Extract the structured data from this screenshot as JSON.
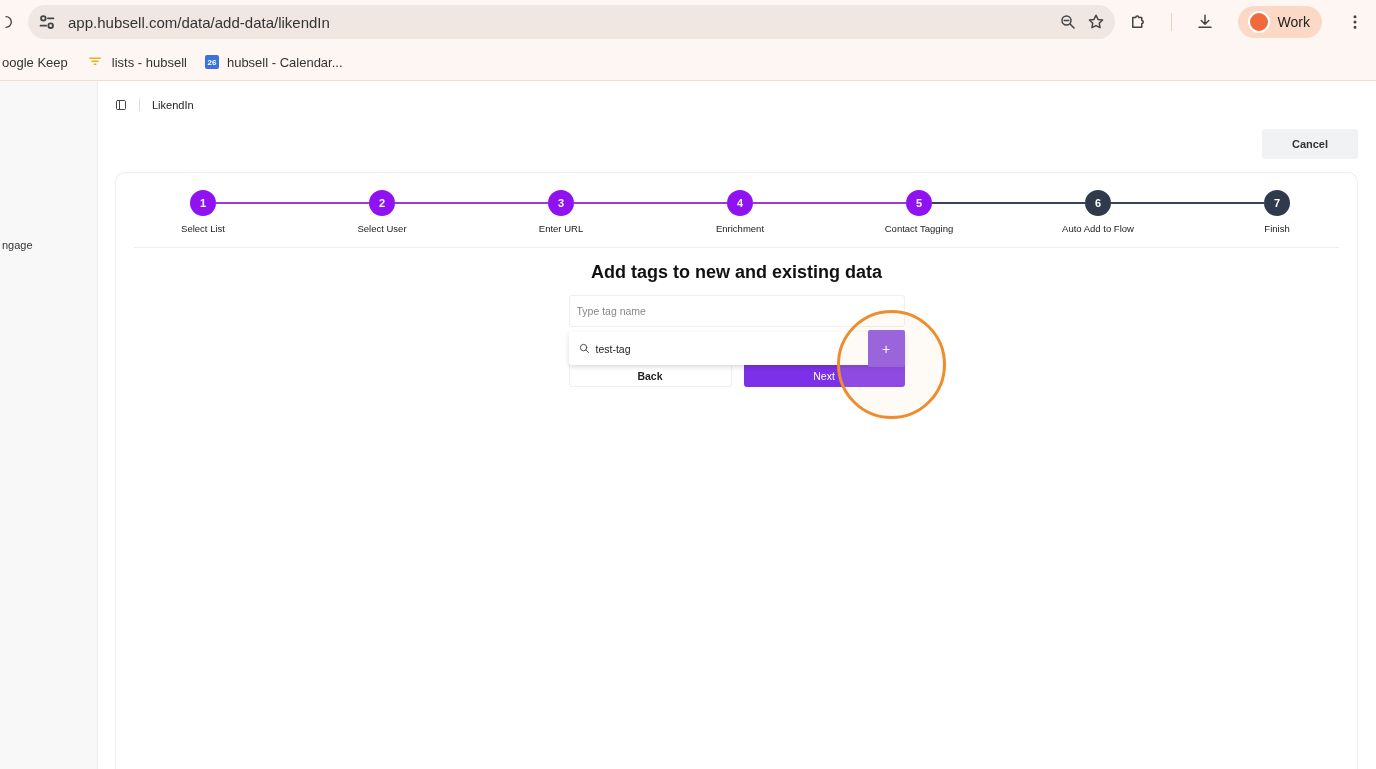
{
  "browser": {
    "url": "app.hubsell.com/data/add-data/likendIn",
    "profile": "Work",
    "bookmarks": [
      {
        "kind": "plain",
        "label": "oogle Keep"
      },
      {
        "kind": "funnel",
        "label": "lists - hubsell"
      },
      {
        "kind": "calendar",
        "badge": "26",
        "label": "hubsell - Calendar..."
      }
    ]
  },
  "sidebar": {
    "items": [
      {
        "label": "ngage"
      }
    ]
  },
  "breadcrumb": "LikendIn",
  "cancel_button": "Cancel",
  "steps": [
    {
      "number": "1",
      "label": "Select List",
      "completed": true
    },
    {
      "number": "2",
      "label": "Select User",
      "completed": true
    },
    {
      "number": "3",
      "label": "Enter URL",
      "completed": true
    },
    {
      "number": "4",
      "label": "Enrichment",
      "completed": true
    },
    {
      "number": "5",
      "label": "Contact Tagging",
      "completed": true
    },
    {
      "number": "6",
      "label": "Auto Add to Flow",
      "completed": false
    },
    {
      "number": "7",
      "label": "Finish",
      "completed": false
    }
  ],
  "heading": "Add tags to new and existing data",
  "tag_input": {
    "placeholder": "Type tag name"
  },
  "tag_dropdown": {
    "search_value": "test-tag",
    "add_button": "+"
  },
  "buttons": {
    "back": "Back",
    "next": "Next"
  }
}
